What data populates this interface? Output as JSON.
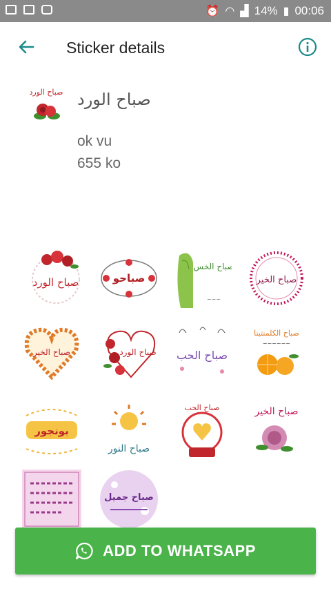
{
  "status_bar": {
    "battery_percent": "14%",
    "time": "00:06"
  },
  "header": {
    "title": "Sticker details"
  },
  "pack": {
    "name": "صباح الورد",
    "author": "ok vu",
    "size": "655 ko"
  },
  "stickers": [
    {
      "text": "صباح الورد"
    },
    {
      "text": "صباحو"
    },
    {
      "text": "صباح الخس"
    },
    {
      "text": "صباح الخير"
    },
    {
      "text": "صباح الخير"
    },
    {
      "text": "صباح الورد"
    },
    {
      "text": "صباح الحب"
    },
    {
      "text": "صباح الكلمنتينا"
    },
    {
      "text": "بونجور"
    },
    {
      "text": "صباح النور"
    },
    {
      "text": "صباح الحب"
    },
    {
      "text": "صباح الخير"
    },
    {
      "text": ""
    },
    {
      "text": "صباح جميل"
    }
  ],
  "actions": {
    "add_label": "ADD TO WHATSAPP"
  },
  "colors": {
    "accent": "#1a8a8a",
    "button": "#4ab34a",
    "status_bar": "#8a8a8a"
  }
}
